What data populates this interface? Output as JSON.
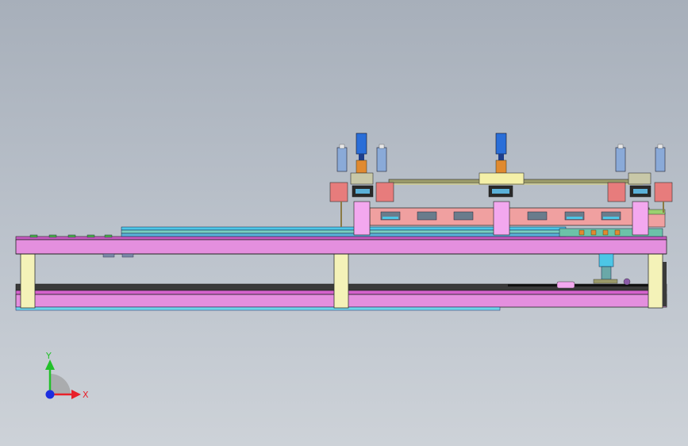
{
  "triad": {
    "y_label": "Y",
    "x_label": "X",
    "y_color": "#22c02a",
    "x_color": "#e8202a",
    "z_color": "#1c2ee0"
  },
  "colors": {
    "frame_pink": "#e48fde",
    "frame_magenta": "#d462cc",
    "leg_yellow": "#f4f2b8",
    "rail_cyan": "#4dc6e6",
    "rail_teal": "#7ad0c0",
    "beam_salmon": "#f0a0a0",
    "olive": "#9a9a6a",
    "cylinder_blue": "#2a6ed8",
    "orange": "#e08a30",
    "dark": "#2a2a2a"
  }
}
